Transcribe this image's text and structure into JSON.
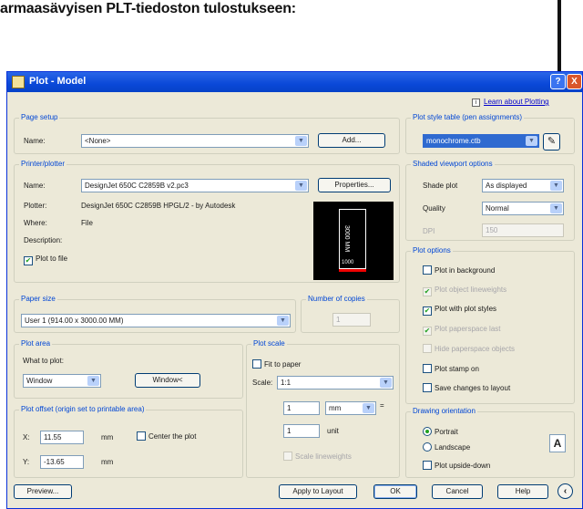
{
  "heading": "armaasävyisen PLT-tiedoston tulostukseen:",
  "dialog": {
    "title": "Plot - Model",
    "help_button": "?",
    "close_button": "X",
    "learn_link": "Learn about Plotting",
    "info_icon": "i"
  },
  "page_setup": {
    "title": "Page setup",
    "name_label": "Name:",
    "name_value": "<None>",
    "add_button": "Add..."
  },
  "printer": {
    "title": "Printer/plotter",
    "name_label": "Name:",
    "name_value": "DesignJet 650C C2859B v2.pc3",
    "properties_button": "Properties...",
    "plotter_label": "Plotter:",
    "plotter_value": "DesignJet 650C C2859B HPGL/2 - by Autodesk",
    "where_label": "Where:",
    "where_value": "File",
    "description_label": "Description:",
    "plot_to_file_label": "Plot to file",
    "plot_to_file_checked": true,
    "preview_dimension": "3000 MM",
    "preview_width": "1000"
  },
  "paper_size": {
    "title": "Paper size",
    "value": "User 1 (914.00 x 3000.00 MM)"
  },
  "copies": {
    "title": "Number of copies",
    "value": "1"
  },
  "plot_area": {
    "title": "Plot area",
    "what_label": "What to plot:",
    "what_value": "Window",
    "window_button": "Window<"
  },
  "plot_scale": {
    "title": "Plot scale",
    "fit_label": "Fit to paper",
    "scale_label": "Scale:",
    "scale_value": "1:1",
    "mm_value": "1",
    "mm_unit": "mm",
    "equals": "=",
    "unit_value": "1",
    "unit_label": "unit",
    "lineweights_label": "Scale lineweights"
  },
  "plot_offset": {
    "title": "Plot offset (origin set to printable area)",
    "x_label": "X:",
    "x_value": "11.55",
    "x_unit": "mm",
    "y_label": "Y:",
    "y_value": "-13.65",
    "y_unit": "mm",
    "center_label": "Center the plot"
  },
  "style_table": {
    "title": "Plot style table (pen assignments)",
    "value": "monochrome.ctb"
  },
  "shaded": {
    "title": "Shaded viewport options",
    "shade_label": "Shade plot",
    "shade_value": "As displayed",
    "quality_label": "Quality",
    "quality_value": "Normal",
    "dpi_label": "DPI",
    "dpi_value": "150"
  },
  "plot_options": {
    "title": "Plot options",
    "items": [
      {
        "label": "Plot in background",
        "checked": false,
        "disabled": false
      },
      {
        "label": "Plot object lineweights",
        "checked": true,
        "disabled": true
      },
      {
        "label": "Plot with plot styles",
        "checked": true,
        "disabled": false
      },
      {
        "label": "Plot paperspace last",
        "checked": true,
        "disabled": true
      },
      {
        "label": "Hide paperspace objects",
        "checked": false,
        "disabled": true
      },
      {
        "label": "Plot stamp on",
        "checked": false,
        "disabled": false
      },
      {
        "label": "Save changes to layout",
        "checked": false,
        "disabled": false
      }
    ]
  },
  "orientation": {
    "title": "Drawing orientation",
    "portrait_label": "Portrait",
    "landscape_label": "Landscape",
    "upside_down_label": "Plot upside-down",
    "orientation_icon": "A"
  },
  "bottom": {
    "preview_button": "Preview...",
    "apply_button": "Apply to Layout",
    "ok_button": "OK",
    "cancel_button": "Cancel",
    "help_button": "Help"
  }
}
